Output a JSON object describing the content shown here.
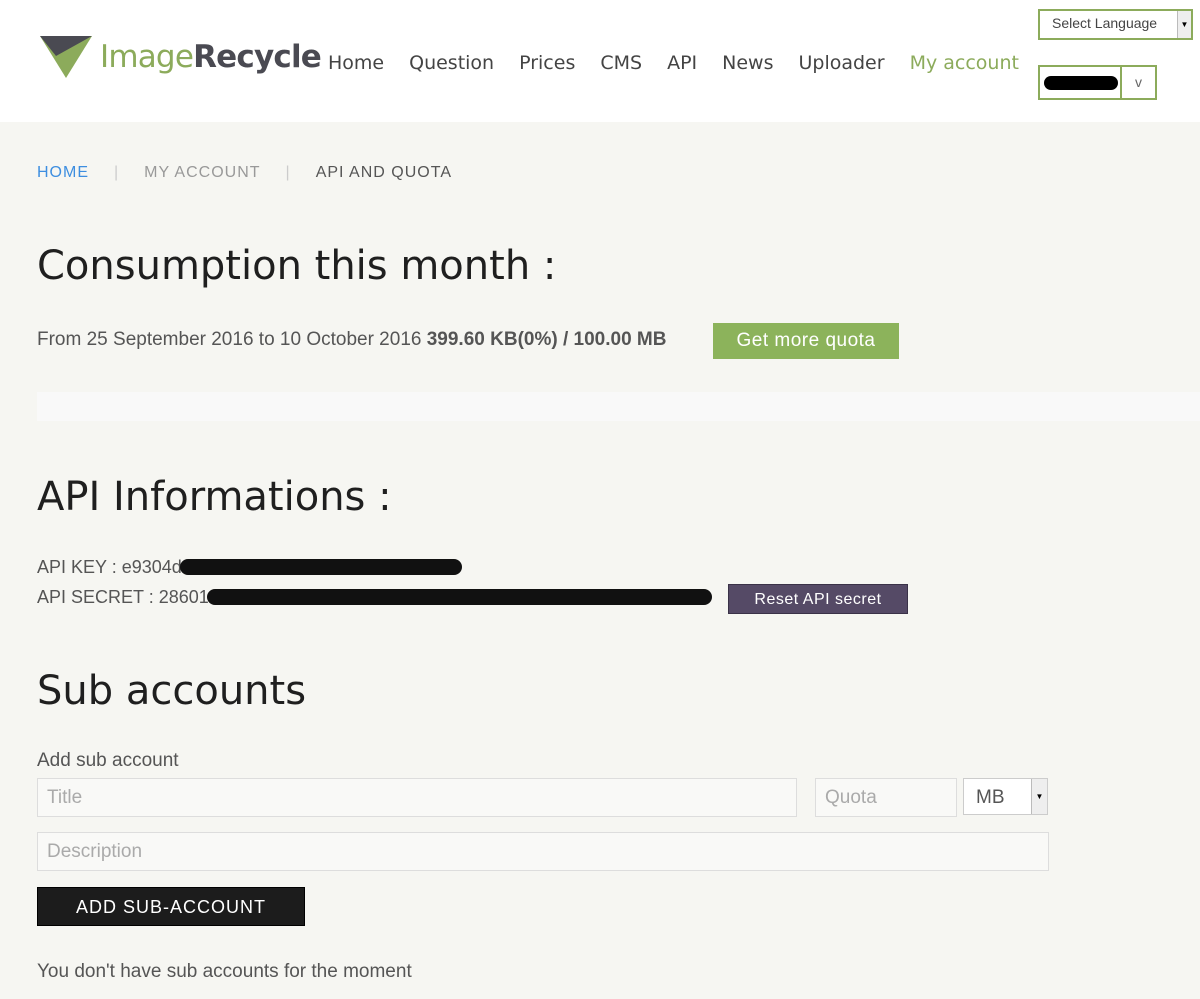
{
  "header": {
    "logo": {
      "text_part1": "Image",
      "text_part2": "Recycle"
    },
    "nav": [
      "Home",
      "Question",
      "Prices",
      "CMS",
      "API",
      "News",
      "Uploader",
      "My account"
    ],
    "active_nav": "My account",
    "language_select": "Select Language",
    "user_toggle": "v"
  },
  "breadcrumb": {
    "home": "HOME",
    "account": "MY ACCOUNT",
    "current": "API AND QUOTA"
  },
  "consumption": {
    "title": "Consumption this month :",
    "period": "From 25 September 2016 to 10 October 2016",
    "usage": "399.60 KB(0%) / 100.00 MB",
    "usage_percent": 0,
    "get_more_quota": "Get more quota"
  },
  "api": {
    "title": "API Informations :",
    "key_label": "API KEY :",
    "key_prefix": "e9304d",
    "secret_label": "API SECRET :",
    "secret_prefix": "28601",
    "reset_button": "Reset API secret"
  },
  "sub_accounts": {
    "title": "Sub accounts",
    "add_label": "Add sub account",
    "title_placeholder": "Title",
    "quota_placeholder": "Quota",
    "unit_value": "MB",
    "description_placeholder": "Description",
    "add_button": "ADD SUB-ACCOUNT",
    "empty_message": "You don't have sub accounts for the moment"
  },
  "colors": {
    "brand_green": "#8cab5b",
    "reset_purple": "#554a66",
    "breadcrumb_link": "#3d8ee0",
    "page_bg": "#f6f6f2"
  }
}
